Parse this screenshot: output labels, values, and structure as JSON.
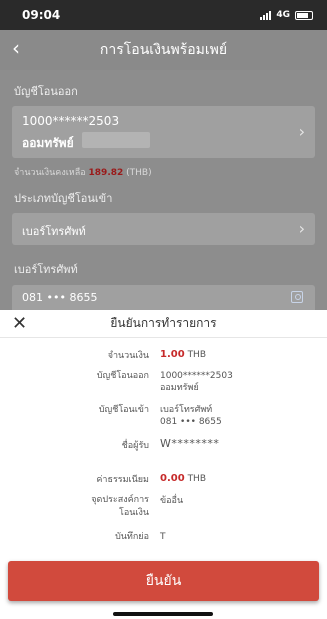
{
  "status": {
    "time": "09:04",
    "network": "4G"
  },
  "nav": {
    "title": "การโอนเงินพร้อมเพย์"
  },
  "from_account": {
    "section_label": "บัญชีโอนออก",
    "number": "1000******2503",
    "type": "ออมทรัพย์",
    "balance_label": "จำนวนเงินคงเหลือ",
    "balance_amount": "189.82",
    "balance_currency": "(THB)"
  },
  "to_type": {
    "section_label": "ประเภทบัญชีโอนเข้า",
    "value": "เบอร์โทรศัพท์"
  },
  "phone": {
    "section_label": "เบอร์โทรศัพท์",
    "value": "081 ••• 8655"
  },
  "sheet": {
    "title": "ยืนยันการทำรายการ",
    "rows": [
      {
        "label": "จำนวนเงิน",
        "value": "1.00",
        "unit": "THB"
      },
      {
        "label": "บัญชีโอนออก",
        "line1": "1000******2503",
        "line2": "ออมทรัพย์"
      },
      {
        "label": "บัญชีโอนเข้า",
        "line1": "เบอร์โทรศัพท์",
        "line2": "081 ••• 8655"
      },
      {
        "label": "ชื่อผู้รับ",
        "value": "W********"
      },
      {
        "label": "ค่าธรรมเนียม",
        "value": "0.00",
        "unit": "THB"
      },
      {
        "label_line1": "จุดประสงค์การ",
        "label_line2": "โอนเงิน",
        "value": "ข้ออื่น"
      },
      {
        "label": "บันทึกย่อ",
        "value": "T"
      }
    ],
    "confirm_label": "ยืนยัน"
  },
  "colors": {
    "accent": "#d14a3d",
    "amount_red": "#c62a2a"
  }
}
